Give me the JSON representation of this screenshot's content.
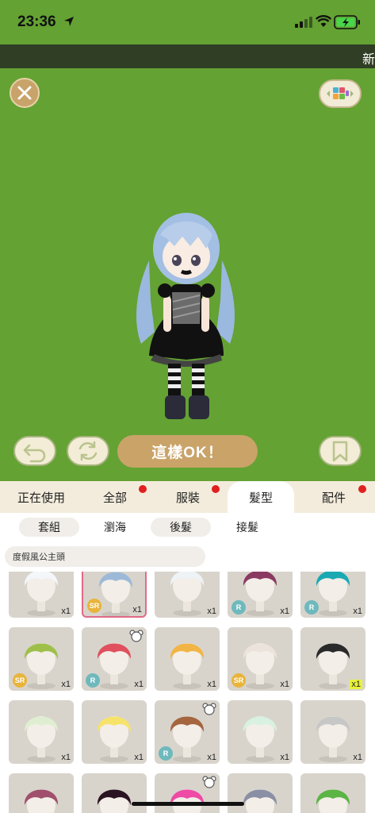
{
  "status": {
    "time": "23:36"
  },
  "ticker": {
    "text": "新"
  },
  "actions": {
    "ok_label": "這樣OK！"
  },
  "tabs": [
    {
      "label": "正在使用",
      "dot": false
    },
    {
      "label": "全部",
      "dot": true
    },
    {
      "label": "服裝",
      "dot": true
    },
    {
      "label": "髮型",
      "dot": false,
      "active": true
    },
    {
      "label": "配件",
      "dot": true
    }
  ],
  "subtabs": [
    {
      "label": "套組"
    },
    {
      "label": "瀏海",
      "active": true
    },
    {
      "label": "後髮"
    },
    {
      "label": "接髮"
    }
  ],
  "filter": {
    "label": "度假風公主頭"
  },
  "items": [
    {
      "hair_color": "#f4f7fa",
      "qty": "x1",
      "badge": ""
    },
    {
      "hair_color": "#9db9d8",
      "qty": "x1",
      "badge": "SR",
      "selected": true
    },
    {
      "hair_color": "#eef3f6",
      "qty": "x1",
      "badge": ""
    },
    {
      "hair_color": "#8a3a62",
      "qty": "x1",
      "badge": "R"
    },
    {
      "hair_color": "#1aa9b2",
      "qty": "x1",
      "badge": "R"
    },
    {
      "hair_color": "#9ec04a",
      "qty": "x1",
      "badge": "SR"
    },
    {
      "hair_color": "#e0505e",
      "qty": "x1",
      "badge": "R",
      "bear": true
    },
    {
      "hair_color": "#f2b445",
      "qty": "x1",
      "badge": ""
    },
    {
      "hair_color": "#ece3dc",
      "qty": "x1",
      "badge": "SR"
    },
    {
      "hair_color": "#2a2a2a",
      "qty": "x1",
      "badge": "",
      "highlight": true
    },
    {
      "hair_color": "#dfeed0",
      "qty": "x1",
      "badge": ""
    },
    {
      "hair_color": "#f7e36a",
      "qty": "x1",
      "badge": ""
    },
    {
      "hair_color": "#a5653f",
      "qty": "x1",
      "badge": "R",
      "bear": true
    },
    {
      "hair_color": "#d8f1e0",
      "qty": "x1",
      "badge": ""
    },
    {
      "hair_color": "#c7c7c7",
      "qty": "x1",
      "badge": ""
    },
    {
      "hair_color": "#a0506c",
      "qty": "",
      "badge": ""
    },
    {
      "hair_color": "#2b1422",
      "qty": "",
      "badge": ""
    },
    {
      "hair_color": "#ee4aa6",
      "qty": "",
      "badge": "",
      "bear": true
    },
    {
      "hair_color": "#8a8fa5",
      "qty": "",
      "badge": ""
    },
    {
      "hair_color": "#5cb445",
      "qty": "",
      "badge": ""
    }
  ]
}
